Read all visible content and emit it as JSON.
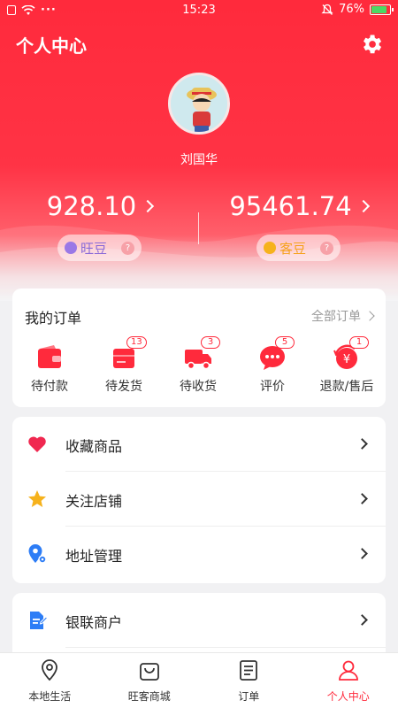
{
  "status_bar": {
    "time": "15:23",
    "battery": "76%",
    "battery_level": 0.76
  },
  "header": {
    "title": "个人中心"
  },
  "profile": {
    "username": "刘国华"
  },
  "balances": [
    {
      "value": "928.10",
      "coin_label": "旺豆",
      "help": "?"
    },
    {
      "value": "95461.74",
      "coin_label": "客豆",
      "help": "?"
    }
  ],
  "orders": {
    "title": "我的订单",
    "all_label": "全部订单",
    "items": [
      {
        "label": "待付款",
        "badge": ""
      },
      {
        "label": "待发货",
        "badge": "13"
      },
      {
        "label": "待收货",
        "badge": "3"
      },
      {
        "label": "评价",
        "badge": "5"
      },
      {
        "label": "退款/售后",
        "badge": "1"
      }
    ]
  },
  "menu": [
    {
      "label": "收藏商品",
      "icon": "heart-icon"
    },
    {
      "label": "关注店铺",
      "icon": "star-icon"
    },
    {
      "label": "地址管理",
      "icon": "location-gear-icon"
    },
    {
      "label": "银联商户",
      "icon": "document-edit-icon"
    }
  ],
  "tabbar": [
    {
      "label": "本地生活",
      "icon": "location-pin-icon",
      "active": false
    },
    {
      "label": "旺客商城",
      "icon": "shopping-bag-icon",
      "active": false
    },
    {
      "label": "订单",
      "icon": "order-list-icon",
      "active": false
    },
    {
      "label": "个人中心",
      "icon": "user-icon",
      "active": true
    }
  ],
  "colors": {
    "brand": "#ff2a3c",
    "coin_purple": "#8a6ad8",
    "coin_orange": "#f6a21c",
    "star": "#f6b21c",
    "location": "#2d7df6"
  }
}
